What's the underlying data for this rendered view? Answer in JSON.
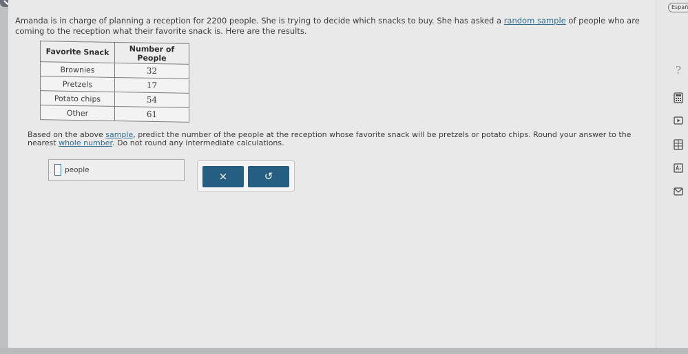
{
  "problem": {
    "text_before_link": "Amanda is in charge of planning a reception for 2200 people. She is trying to decide which snacks to buy. She has asked a ",
    "link": "random sample",
    "text_after_link": " of people who are coming to the reception what their favorite snack is. Here are the results."
  },
  "table": {
    "headers": [
      "Favorite Snack",
      "Number of People"
    ],
    "rows": [
      {
        "snack": "Brownies",
        "count": "32"
      },
      {
        "snack": "Pretzels",
        "count": "17"
      },
      {
        "snack": "Potato chips",
        "count": "54"
      },
      {
        "snack": "Other",
        "count": "61"
      }
    ]
  },
  "question": {
    "part1": "Based on the above ",
    "link1": "sample",
    "part2": ", predict the number of the people at the reception whose favorite snack will be pretzels or potato chips. Round your answer to the nearest ",
    "link2": "whole number",
    "part3": ". Do not round any intermediate calculations."
  },
  "answer": {
    "value": "",
    "unit": "people"
  },
  "buttons": {
    "clear": "×",
    "undo": "↺"
  },
  "sidebar": {
    "language": "Español",
    "help": "?"
  },
  "colors": {
    "accent": "#255e80",
    "link": "#2f6f92",
    "background": "#e9e9ea"
  }
}
